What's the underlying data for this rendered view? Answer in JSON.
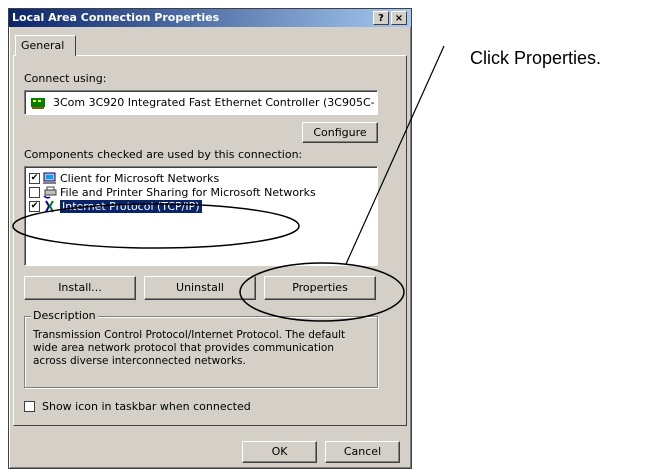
{
  "callout": {
    "text": "Click Properties."
  },
  "dialog": {
    "title": "Local Area Connection Properties",
    "help_label": "?",
    "close_label": "×",
    "tab_label": "General",
    "connect_using_label": "Connect using:",
    "adapter_name": "3Com 3C920 Integrated Fast Ethernet Controller (3C905C-",
    "configure_label": "Configure",
    "components_label": "Components checked are used by this connection:",
    "components": [
      {
        "label": "Client for Microsoft Networks",
        "checked": true,
        "icon": "network-client-icon"
      },
      {
        "label": "File and Printer Sharing for Microsoft Networks",
        "checked": false,
        "icon": "printer-sharing-icon"
      },
      {
        "label": "Internet Protocol (TCP/IP)",
        "checked": true,
        "icon": "protocol-icon",
        "selected": true
      }
    ],
    "install_label": "Install...",
    "uninstall_label": "Uninstall",
    "properties_label": "Properties",
    "description_title": "Description",
    "description_text": "Transmission Control Protocol/Internet Protocol. The default wide area network protocol that provides communication across diverse interconnected networks.",
    "show_icon_label": "Show icon in taskbar when connected",
    "show_icon_checked": false,
    "ok_label": "OK",
    "cancel_label": "Cancel"
  }
}
